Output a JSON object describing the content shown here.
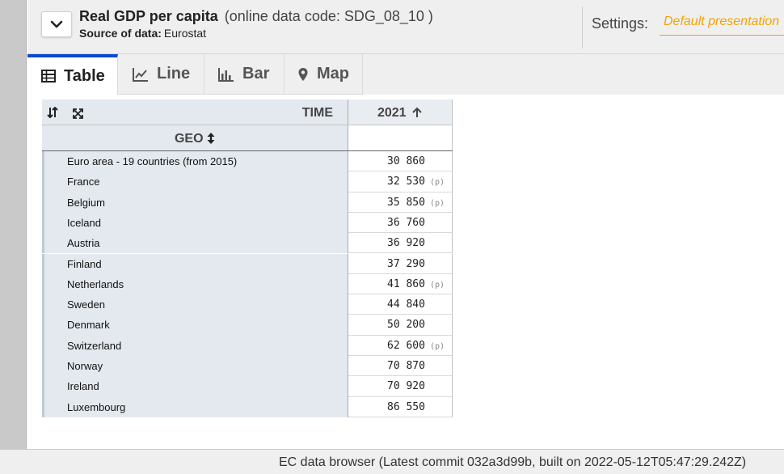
{
  "header": {
    "title": "Real GDP per capita",
    "code": "(online data code: SDG_08_10 )",
    "source_label": "Source of data:",
    "source_value": "Eurostat",
    "settings_label": "Settings:",
    "settings_value": "Default presentation"
  },
  "tabs": [
    {
      "label": "Table",
      "icon": "table-icon",
      "active": true
    },
    {
      "label": "Line",
      "icon": "line-chart-icon",
      "active": false
    },
    {
      "label": "Bar",
      "icon": "bar-chart-icon",
      "active": false
    },
    {
      "label": "Map",
      "icon": "map-marker-icon",
      "active": false
    }
  ],
  "table": {
    "time_header": "TIME",
    "geo_header": "GEO",
    "year": "2021",
    "rows": [
      {
        "geo": "Euro area - 19 countries (from 2015)",
        "value": "30 860",
        "flag": ""
      },
      {
        "geo": "France",
        "value": "32 530",
        "flag": "(p)"
      },
      {
        "geo": "Belgium",
        "value": "35 850",
        "flag": "(p)"
      },
      {
        "geo": "Iceland",
        "value": "36 760",
        "flag": ""
      },
      {
        "geo": "Austria",
        "value": "36 920",
        "flag": ""
      },
      {
        "geo": "Finland",
        "value": "37 290",
        "flag": ""
      },
      {
        "geo": "Netherlands",
        "value": "41 860",
        "flag": "(p)"
      },
      {
        "geo": "Sweden",
        "value": "44 840",
        "flag": ""
      },
      {
        "geo": "Denmark",
        "value": "50 200",
        "flag": ""
      },
      {
        "geo": "Switzerland",
        "value": "62 600",
        "flag": "(p)"
      },
      {
        "geo": "Norway",
        "value": "70 870",
        "flag": ""
      },
      {
        "geo": "Ireland",
        "value": "70 920",
        "flag": ""
      },
      {
        "geo": "Luxembourg",
        "value": "86 550",
        "flag": ""
      }
    ]
  },
  "footer": {
    "text": "EC data browser (Latest commit 032a3d99b, built on 2022-05-12T05:47:29.242Z)"
  },
  "colors": {
    "active_tab_accent": "#0e47cb",
    "settings_accent": "#f0a400",
    "geo_column_bg": "#e4e9ef"
  }
}
